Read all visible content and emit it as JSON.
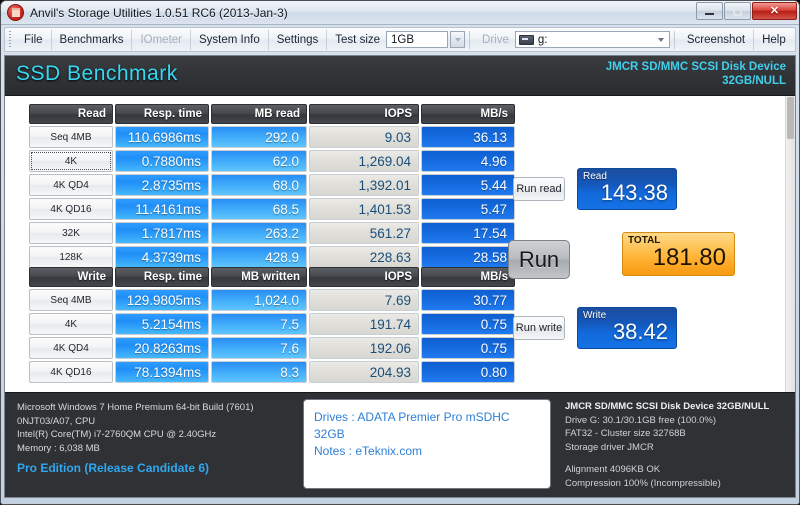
{
  "window": {
    "title": "Anvil's Storage Utilities 1.0.51 RC6 (2013-Jan-3)",
    "icon": "anvil-icon",
    "minimize_label": "Minimize",
    "maximize_label": "Maximize",
    "close_label": "Close"
  },
  "menu": {
    "items": [
      {
        "label": "File",
        "disabled": false
      },
      {
        "label": "Benchmarks",
        "disabled": false
      },
      {
        "label": "IOmeter",
        "disabled": true
      },
      {
        "label": "System Info",
        "disabled": false
      },
      {
        "label": "Settings",
        "disabled": false
      }
    ],
    "test_size_label": "Test size",
    "test_size_value": "1GB",
    "drive_label": "Drive",
    "drive_value": "g:",
    "screenshot_label": "Screenshot",
    "help_label": "Help"
  },
  "header": {
    "title": "SSD Benchmark",
    "device_line1": "JMCR SD/MMC SCSI Disk Device",
    "device_line2": "32GB/NULL",
    "accent_color": "#36d8f2"
  },
  "read_table": {
    "columns": [
      "Read",
      "Resp. time",
      "MB read",
      "IOPS",
      "MB/s"
    ],
    "rows": [
      {
        "label": "Seq 4MB",
        "focused": false,
        "resp": "110.6986ms",
        "mb": "292.0",
        "iops": "9.03",
        "mbs": "36.13"
      },
      {
        "label": "4K",
        "focused": true,
        "resp": "0.7880ms",
        "mb": "62.0",
        "iops": "1,269.04",
        "mbs": "4.96"
      },
      {
        "label": "4K QD4",
        "focused": false,
        "resp": "2.8735ms",
        "mb": "68.0",
        "iops": "1,392.01",
        "mbs": "5.44"
      },
      {
        "label": "4K QD16",
        "focused": false,
        "resp": "11.4161ms",
        "mb": "68.5",
        "iops": "1,401.53",
        "mbs": "5.47"
      },
      {
        "label": "32K",
        "focused": false,
        "resp": "1.7817ms",
        "mb": "263.2",
        "iops": "561.27",
        "mbs": "17.54"
      },
      {
        "label": "128K",
        "focused": false,
        "resp": "4.3739ms",
        "mb": "428.9",
        "iops": "228.63",
        "mbs": "28.58"
      }
    ]
  },
  "write_table": {
    "columns": [
      "Write",
      "Resp. time",
      "MB written",
      "IOPS",
      "MB/s"
    ],
    "rows": [
      {
        "label": "Seq 4MB",
        "focused": false,
        "resp": "129.9805ms",
        "mb": "1,024.0",
        "iops": "7.69",
        "mbs": "30.77"
      },
      {
        "label": "4K",
        "focused": false,
        "resp": "5.2154ms",
        "mb": "7.5",
        "iops": "191.74",
        "mbs": "0.75"
      },
      {
        "label": "4K QD4",
        "focused": false,
        "resp": "20.8263ms",
        "mb": "7.6",
        "iops": "192.06",
        "mbs": "0.75"
      },
      {
        "label": "4K QD16",
        "focused": false,
        "resp": "78.1394ms",
        "mb": "8.3",
        "iops": "204.93",
        "mbs": "0.80"
      }
    ]
  },
  "actions": {
    "run_read": "Run read",
    "run": "Run",
    "run_write": "Run write"
  },
  "scores": {
    "read_label": "Read",
    "read_value": "143.38",
    "total_label": "TOTAL",
    "total_value": "181.80",
    "write_label": "Write",
    "write_value": "38.42",
    "read_color": "#1268d8",
    "total_color": "#ffab2a",
    "write_color": "#1268d8"
  },
  "footer": {
    "system": [
      "Microsoft Windows 7 Home Premium  64-bit Build (7601)",
      "0NJT03/A07, CPU",
      "Intel(R) Core(TM) i7-2760QM CPU @ 2.40GHz",
      "Memory : 6,038 MB"
    ],
    "edition": "Pro Edition (Release Candidate 6)",
    "notes": [
      "Drives : ADATA Premier Pro mSDHC 32GB",
      "Notes : eTeknix.com"
    ],
    "drive_info": [
      "JMCR SD/MMC SCSI Disk Device 32GB/NULL",
      "Drive G: 30.1/30.1GB free (100.0%)",
      "FAT32 - Cluster size 32768B",
      "Storage driver  JMCR"
    ],
    "drive_extra": [
      "Alignment 4096KB OK",
      "Compression 100% (Incompressible)"
    ]
  }
}
